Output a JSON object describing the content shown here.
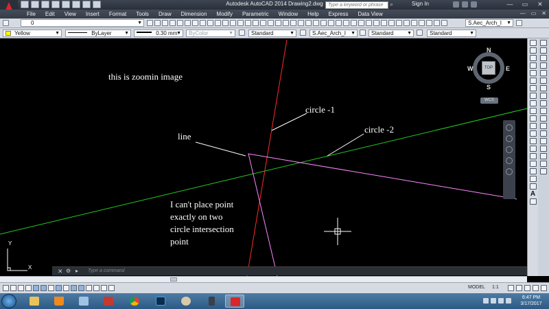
{
  "titlebar": {
    "window_title": "Autodesk AutoCAD 2014    Drawing2.dwg",
    "search_placeholder": "Type a keyword or phrase",
    "signin_label": "Sign In",
    "win_min": "—",
    "win_max": "▭",
    "win_close": "✕"
  },
  "menubar": {
    "items": [
      "File",
      "Edit",
      "View",
      "Insert",
      "Format",
      "Tools",
      "Draw",
      "Dimension",
      "Modify",
      "Parametric",
      "Window",
      "Help",
      "Express",
      "Data View"
    ]
  },
  "toolbar1": {
    "layer_value": "0",
    "text_style_value": "S.Aec_Arch_I"
  },
  "toolbar2": {
    "color_value": "Yellow",
    "linetype_value": "ByLayer",
    "lineweight_value": "0.30 mm",
    "plotstyle_value": "ByColor",
    "textstyle_value": "Standard",
    "dimstyle_value": "S.Aec_Arch_I",
    "tablestyle_value": "Standard",
    "mleaderstyle_value": "Standard",
    "color_hex": "#ffff00"
  },
  "drawing": {
    "background": "#000000",
    "annotations": {
      "zoom_note": "this is zoomin image",
      "circle1_label": "circle -1",
      "circle2_label": "circle -2",
      "line_label": "line",
      "problem_line1": "I can't place point",
      "problem_line2": "exactly on two",
      "problem_line3": "circle intersection",
      "problem_line4": "point"
    },
    "colors": {
      "circle1": "#ff2a2a",
      "circle2": "#22cc22",
      "line": "#ff88ff",
      "leaders": "#ffffff"
    }
  },
  "viewcube": {
    "north": "N",
    "south": "S",
    "east": "E",
    "west": "W",
    "top_face": "TOP",
    "wcs_label": "WCS"
  },
  "ucs": {
    "x_label": "X",
    "y_label": "Y"
  },
  "cmdline": {
    "close_glyph": "✕",
    "placeholder": "Type a command"
  },
  "statusbar": {
    "model_label": "MODEL",
    "scale_label": "1:1"
  },
  "taskbar": {
    "clock_time": "6:47 PM",
    "clock_date": "3/17/2017"
  }
}
